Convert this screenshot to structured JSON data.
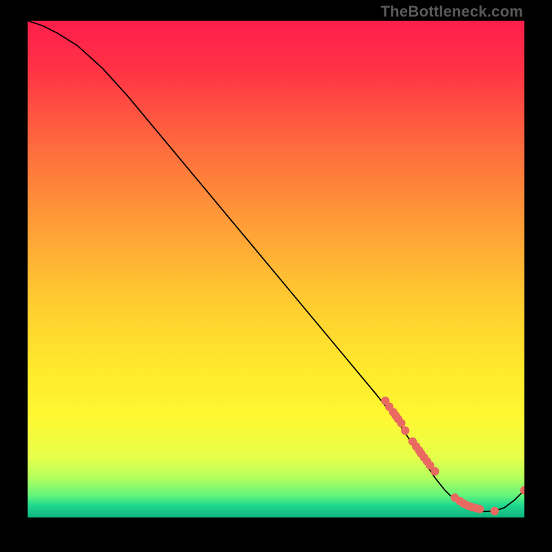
{
  "watermark": "TheBottleneck.com",
  "chart_data": {
    "type": "line",
    "title": "",
    "xlabel": "",
    "ylabel": "",
    "xlim": [
      0,
      100
    ],
    "ylim": [
      0,
      100
    ],
    "curve": {
      "name": "bottleneck-curve",
      "x": [
        0,
        3,
        6,
        10,
        15,
        20,
        25,
        30,
        35,
        40,
        45,
        50,
        55,
        60,
        65,
        70,
        72,
        74,
        76,
        78,
        80,
        82,
        84,
        86,
        88,
        90,
        92,
        94,
        96,
        98,
        100
      ],
      "y": [
        100,
        99,
        97.5,
        95,
        90.5,
        85,
        79,
        73,
        67,
        61,
        55,
        49,
        43,
        37,
        31,
        25,
        22.5,
        20,
        17,
        14,
        11,
        8,
        5.5,
        3.5,
        2.2,
        1.5,
        1.2,
        1.3,
        2.0,
        3.5,
        5.5
      ]
    },
    "points": {
      "name": "sample-points",
      "color": "#e86a60",
      "x": [
        72,
        72.8,
        73.6,
        74.1,
        74.6,
        75.2,
        76,
        77.5,
        78.2,
        78.8,
        79.2,
        79.8,
        80.4,
        81,
        82,
        86,
        87,
        87.8,
        88.6,
        89.4,
        90.2,
        91,
        94,
        100
      ],
      "y": [
        23.5,
        22.3,
        21.2,
        20.5,
        19.8,
        19.0,
        17.5,
        15.3,
        14.3,
        13.5,
        12.9,
        12.1,
        11.3,
        10.5,
        9.3,
        4.0,
        3.3,
        2.8,
        2.4,
        2.1,
        1.9,
        1.7,
        1.3,
        5.5
      ]
    },
    "background_gradient": {
      "stops": [
        {
          "offset": 0.0,
          "color": "#ff1e4b"
        },
        {
          "offset": 0.1,
          "color": "#ff3345"
        },
        {
          "offset": 0.25,
          "color": "#ff6a3e"
        },
        {
          "offset": 0.4,
          "color": "#ff9a38"
        },
        {
          "offset": 0.55,
          "color": "#ffc831"
        },
        {
          "offset": 0.7,
          "color": "#ffe92c"
        },
        {
          "offset": 0.8,
          "color": "#fff832"
        },
        {
          "offset": 0.88,
          "color": "#e6ff4a"
        },
        {
          "offset": 0.92,
          "color": "#b4ff5e"
        },
        {
          "offset": 0.955,
          "color": "#66f57a"
        },
        {
          "offset": 0.975,
          "color": "#20d98f"
        },
        {
          "offset": 1.0,
          "color": "#0fb57f"
        }
      ]
    }
  }
}
